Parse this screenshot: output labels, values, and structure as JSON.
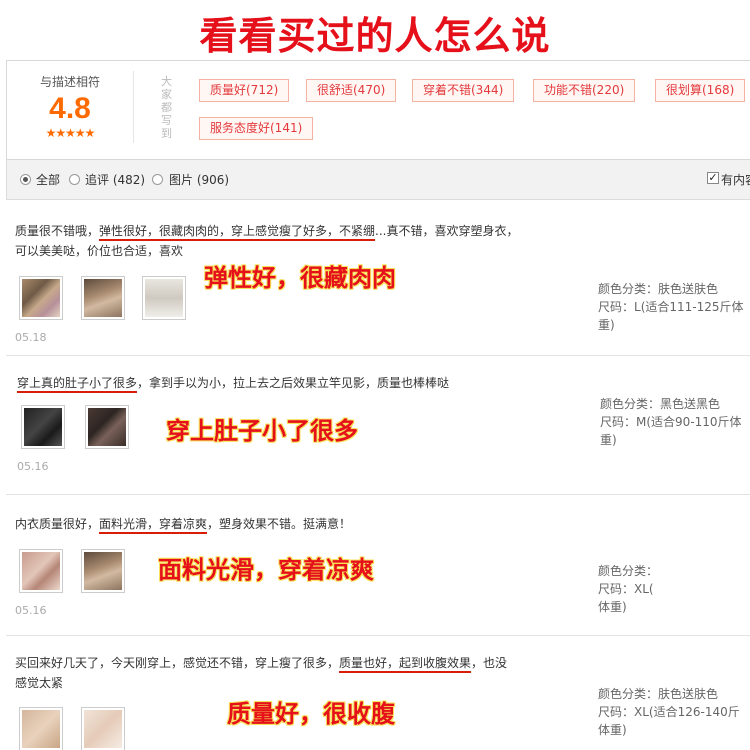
{
  "banner": {
    "title": "看看买过的人怎么说"
  },
  "summary": {
    "score_label": "与描述相符",
    "score": "4.8",
    "stars": "★★★★★",
    "everyone_label": "大家都写到",
    "tags": [
      "质量好(712)",
      "很舒适(470)",
      "穿着不错(344)",
      "功能不错(220)",
      "很划算(168)",
      "服务态度好(141)"
    ]
  },
  "filters": {
    "all": "全部",
    "followup": "追评 (482)",
    "pictures": "图片 (906)",
    "has_content": "有内容"
  },
  "meta_labels": {
    "color": "颜色分类：",
    "size": "尺码："
  },
  "reviews": [
    {
      "pre": "质量很不错哦，",
      "hl1": "弹性很好，很藏肉肉的，穿上感觉瘦了好多，不紧绷",
      "post": "...真不错，喜欢穿塑身衣，",
      "line2": "可以美美哒，价位也合适，喜欢",
      "callout": "弹性好，很藏肉肉",
      "date": "05.18",
      "color": "肤色送肤色",
      "size_line1": "L(适合111-125斤体",
      "size_line2": "重)"
    },
    {
      "hl1": "穿上真的肚子小了很多",
      "post": "，拿到手以为小，拉上去之后效果立竿见影，质量也棒棒哒",
      "callout": "穿上肚子小了很多",
      "date": "05.16",
      "color": "黑色送黑色",
      "size_line1": "M(适合90-110斤体",
      "size_line2": "重)"
    },
    {
      "pre": "内衣质量很好，",
      "hl1": "面料光滑，穿着凉爽",
      "post": "，塑身效果不错。挺满意！",
      "callout": "面料光滑，穿着凉爽",
      "date": "05.16",
      "color": "",
      "size_line1": "XL(",
      "size_line2": "体重)"
    },
    {
      "pre": "买回来好几天了，今天刚穿上，感觉还不错，穿上瘦了很多，",
      "hl1": "质量也好，起到收腹效果",
      "post": "，也没",
      "line2": "感觉太紧",
      "callout": "质量好，很收腹",
      "color": "肤色送肤色",
      "size_line1": "XL(适合126-140斤",
      "size_line2": "体重)"
    }
  ]
}
